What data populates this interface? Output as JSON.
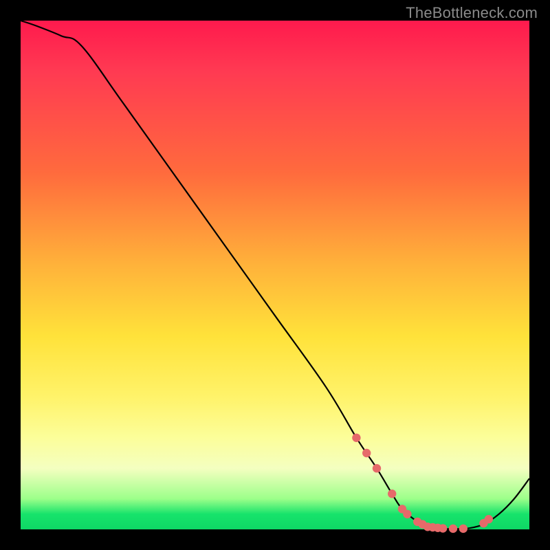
{
  "watermark": "TheBottleneck.com",
  "chart_data": {
    "type": "line",
    "title": "",
    "xlabel": "",
    "ylabel": "",
    "xlim": [
      0,
      100
    ],
    "ylim": [
      0,
      100
    ],
    "series": [
      {
        "name": "bottleneck-curve",
        "x": [
          0,
          3,
          8,
          12,
          20,
          30,
          40,
          50,
          60,
          66,
          70,
          73,
          75,
          78,
          80,
          82,
          84,
          86,
          88,
          91,
          94,
          97,
          100
        ],
        "values": [
          100,
          99,
          97,
          95,
          84,
          70,
          56,
          42,
          28,
          18,
          12,
          7,
          4,
          1.5,
          0.5,
          0.2,
          0.1,
          0.1,
          0.2,
          1,
          3,
          6,
          10
        ]
      }
    ],
    "markers": {
      "name": "highlight-points",
      "x": [
        66,
        68,
        70,
        73,
        75,
        76,
        78,
        79,
        80,
        81,
        82,
        83,
        85,
        87,
        91,
        92
      ],
      "values": [
        18,
        15,
        12,
        7,
        4,
        3,
        1.5,
        1,
        0.5,
        0.4,
        0.3,
        0.2,
        0.15,
        0.15,
        1.2,
        2
      ]
    },
    "gradient_stops": [
      {
        "pos": 0,
        "color": "#ff1a4d"
      },
      {
        "pos": 30,
        "color": "#ff6b3d"
      },
      {
        "pos": 60,
        "color": "#ffe23a"
      },
      {
        "pos": 85,
        "color": "#fcfe9a"
      },
      {
        "pos": 97,
        "color": "#17e36b"
      },
      {
        "pos": 100,
        "color": "#0ed765"
      }
    ]
  }
}
